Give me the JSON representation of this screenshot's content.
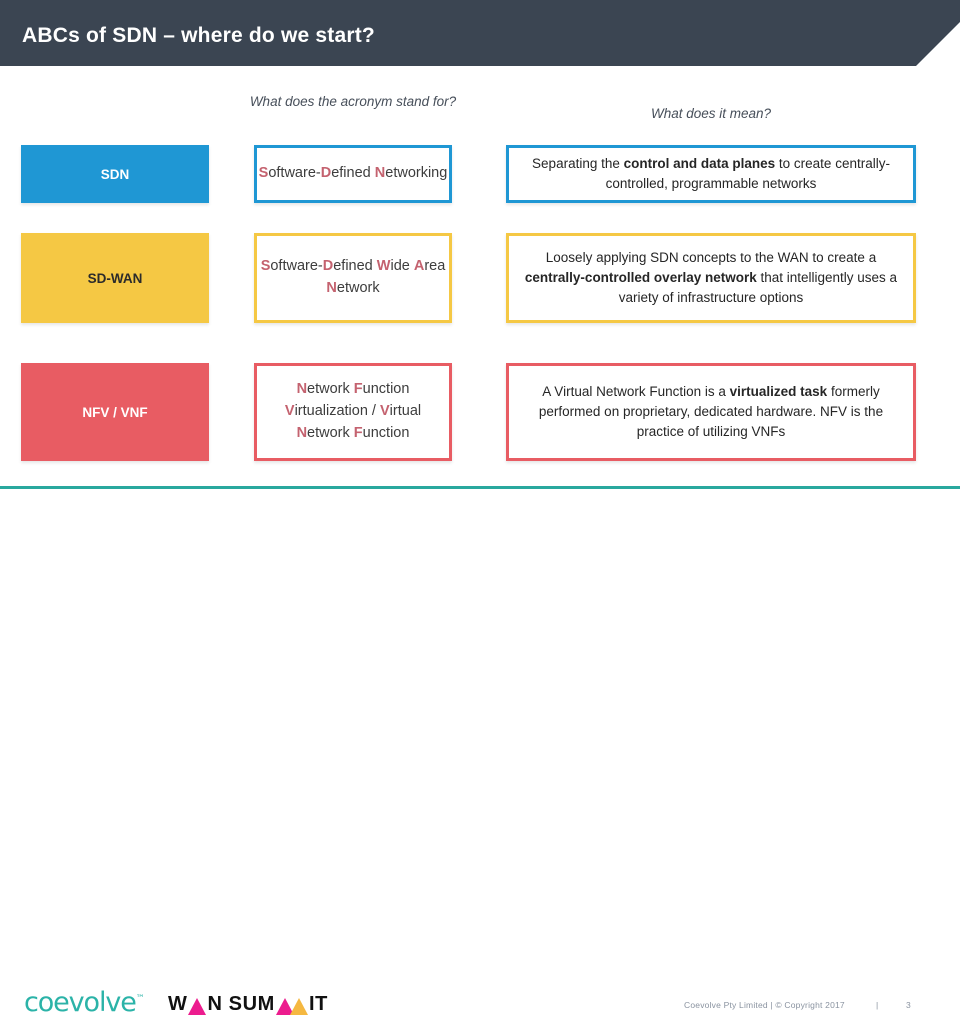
{
  "slide": {
    "title": "ABCs of SDN – where do we start?",
    "header_bg": "#3b4552"
  },
  "table": {
    "headers": {
      "col1": "",
      "col2": "What does the acronym stand for?",
      "col3": "What does it mean?"
    },
    "rows": [
      {
        "label": "SDN",
        "color": "#1f97d4",
        "acronym_parts": [
          {
            "text": "S",
            "highlight": true
          },
          {
            "text": "oftware-",
            "highlight": false
          },
          {
            "text": "D",
            "highlight": true
          },
          {
            "text": "efined ",
            "highlight": false
          },
          {
            "text": "N",
            "highlight": true
          },
          {
            "text": "etworking",
            "highlight": false
          }
        ],
        "acronym_plain": "Software-Defined Networking",
        "meaning_parts": [
          {
            "text": "Separating the ",
            "bold": false
          },
          {
            "text": "control and data planes",
            "bold": true
          },
          {
            "text": " to create centrally-controlled, programmable networks",
            "bold": false
          }
        ],
        "meaning_plain": "Separating the control and data planes to create centrally-controlled, programmable networks"
      },
      {
        "label": "SD-WAN",
        "color": "#f5c844",
        "acronym_parts": [
          {
            "text": "S",
            "highlight": true
          },
          {
            "text": "oftware-",
            "highlight": false
          },
          {
            "text": "D",
            "highlight": true
          },
          {
            "text": "efined ",
            "highlight": false
          },
          {
            "text": "W",
            "highlight": true
          },
          {
            "text": "ide ",
            "highlight": false
          },
          {
            "text": "A",
            "highlight": true
          },
          {
            "text": "rea ",
            "highlight": false
          },
          {
            "text": "N",
            "highlight": true
          },
          {
            "text": "etwork",
            "highlight": false
          }
        ],
        "acronym_plain": "Software-Defined Wide Area Network",
        "meaning_parts": [
          {
            "text": "Loosely applying SDN concepts to the WAN to create a ",
            "bold": false
          },
          {
            "text": "centrally-controlled overlay network",
            "bold": true
          },
          {
            "text": " that intelligently uses a variety of infrastructure options",
            "bold": false
          }
        ],
        "meaning_plain": "Loosely applying SDN concepts to the WAN to create a centrally-controlled overlay network that intelligently uses a variety of infrastructure options"
      },
      {
        "label": "NFV / VNF",
        "color": "#e85c63",
        "acronym_parts": [
          {
            "text": "N",
            "highlight": true
          },
          {
            "text": "etwork ",
            "highlight": false
          },
          {
            "text": "F",
            "highlight": true
          },
          {
            "text": "unction ",
            "highlight": false
          },
          {
            "text": "V",
            "highlight": true
          },
          {
            "text": "irtualization / ",
            "highlight": false
          },
          {
            "text": "V",
            "highlight": true
          },
          {
            "text": "irtual ",
            "highlight": false
          },
          {
            "text": "N",
            "highlight": true
          },
          {
            "text": "etwork ",
            "highlight": false
          },
          {
            "text": "F",
            "highlight": true
          },
          {
            "text": "unction",
            "highlight": false
          }
        ],
        "acronym_plain": "Network Function Virtualization / Virtual Network Function",
        "meaning_parts": [
          {
            "text": "A Virtual Network Function is a ",
            "bold": false
          },
          {
            "text": "virtualized task",
            "bold": true
          },
          {
            "text": " formerly performed on proprietary, dedicated hardware. NFV is the practice of utilizing VNFs",
            "bold": false
          }
        ],
        "meaning_plain": "A Virtual Network Function is a virtualized task formerly performed on proprietary, dedicated hardware. NFV is the practice of utilizing VNFs"
      }
    ],
    "highlight_color": "#c4626f"
  },
  "footer": {
    "rule_color": "#29a89e",
    "logo_coevolve": "coevolve",
    "logo_tm": "™",
    "logo_wansummit_parts": [
      "W",
      "N SUM",
      "IT"
    ],
    "logo_wansummit_plain": "WAN SUMMIT",
    "copyright": "Coevolve Pty Limited  |  © Copyright 2017",
    "separator": "|",
    "page_number": "3"
  }
}
